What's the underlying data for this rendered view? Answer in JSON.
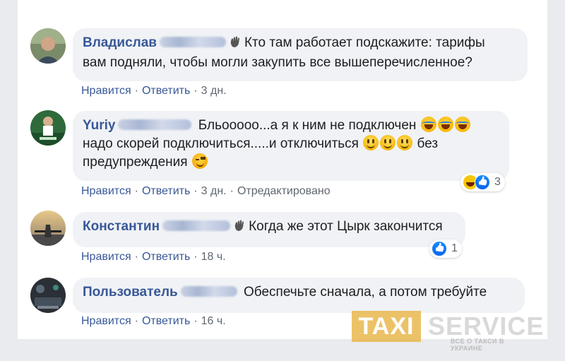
{
  "comments": [
    {
      "author": "Владислав",
      "text_lines": [
        "Кто там работает подскажите: тарифы",
        "вам подняли, чтобы могли закупить все вышеперечисленное?"
      ],
      "actions": {
        "like": "Нравится",
        "reply": "Ответить",
        "time": "3 дн."
      }
    },
    {
      "author": "Yuriy",
      "text_1": "Бльооооо...а я к ним не подключен",
      "text_2a": "надо скорей подключиться.....и отключиться",
      "text_2b": "без",
      "text_3": "предупреждения",
      "actions": {
        "like": "Нравится",
        "reply": "Ответить",
        "time": "3 дн.",
        "edited": "Отредактировано"
      },
      "reaction_count": "3"
    },
    {
      "author": "Константин",
      "text": "Когда же этот Цырк закончится",
      "actions": {
        "like": "Нравится",
        "reply": "Ответить",
        "time": "18 ч."
      },
      "reaction_count": "1"
    },
    {
      "author": "Пользователь",
      "text": "Обеспечьте сначала, а потом требуйте",
      "actions": {
        "like": "Нравится",
        "reply": "Ответить",
        "time": "16 ч."
      }
    }
  ],
  "separator": "·",
  "watermark": {
    "brand_left": "TAXI",
    "brand_right": "SERVICE",
    "tagline": "ВСЕ О ТАКСИ В УКРАИНЕ"
  },
  "colors": {
    "name": "#385898",
    "bubble": "#f0f2f5",
    "page_bg": "#e9ebee",
    "meta": "#606770"
  }
}
